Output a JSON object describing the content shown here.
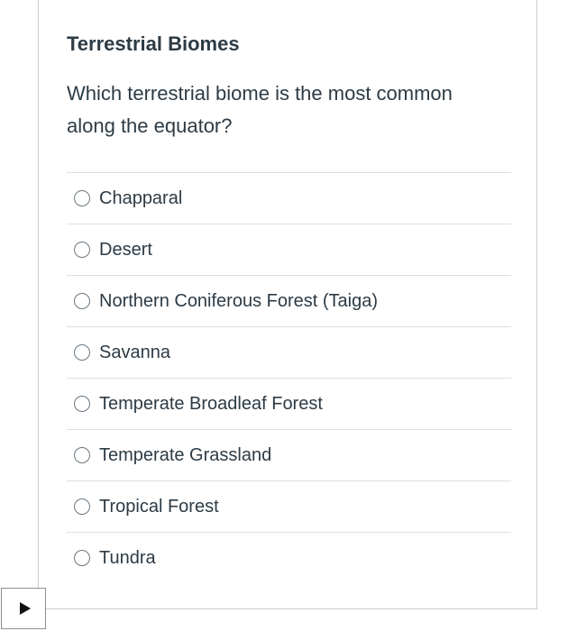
{
  "quiz": {
    "title": "Terrestrial Biomes",
    "question": "Which terrestrial biome is the most common along the equator?",
    "answers": [
      {
        "label": "Chapparal"
      },
      {
        "label": "Desert"
      },
      {
        "label": "Northern Coniferous Forest (Taiga)"
      },
      {
        "label": "Savanna"
      },
      {
        "label": "Temperate Broadleaf Forest"
      },
      {
        "label": "Temperate Grassland"
      },
      {
        "label": "Tropical Forest"
      },
      {
        "label": "Tundra"
      }
    ]
  },
  "controls": {
    "play_icon": "play-icon"
  }
}
